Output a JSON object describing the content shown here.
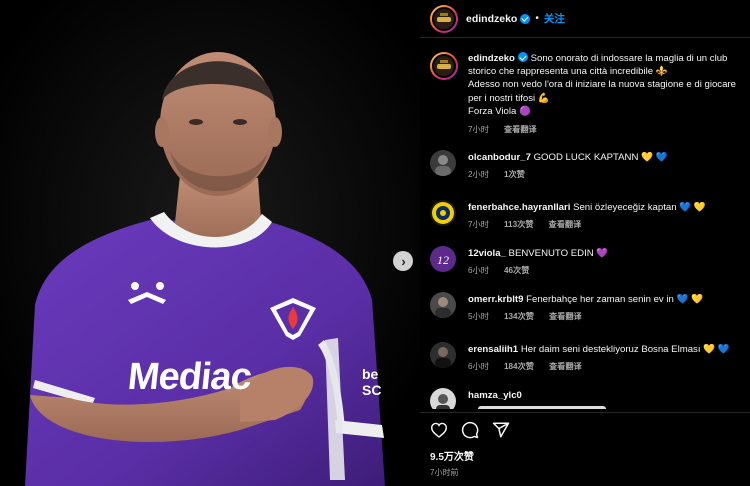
{
  "post": {
    "author": "edindzeko",
    "follow_label": "关注",
    "separator": "•",
    "caption": {
      "line1": "Sono onorato di indossare la maglia di un club storico che rappresenta una città incredibile ⚜️",
      "line2": "Adesso non vedo l'ora di iniziare la nuova stagione e di giocare per i nostri tifosi 💪",
      "line3": "Forza Viola 🟣",
      "time": "7小时",
      "translate": "查看翻译"
    },
    "likes": "9.5万次赞",
    "posted_ago": "7小时前"
  },
  "photo": {
    "jersey_sponsor": "Mediac",
    "jersey_sponsor_right": "be\nSC",
    "slide_count": 2,
    "active_slide": 0
  },
  "comments": [
    {
      "user": "olcanbodur_7",
      "text": "GOOD LUCK KAPTANN 💛 💙",
      "time": "2小时",
      "likes": "1次赞",
      "translate": "",
      "avatar_color": "#3b3b3b"
    },
    {
      "user": "fenerbahce.hayranllari",
      "text": "Seni özleyeceğiz kaptan 💙 💛",
      "time": "7小时",
      "likes": "113次赞",
      "translate": "查看翻译",
      "avatar_color": "#f2d000"
    },
    {
      "user": "12viola_",
      "text": "BENVENUTO EDIN 💜",
      "time": "6小时",
      "likes": "46次赞",
      "translate": "",
      "avatar_color": "#5d2a8c"
    },
    {
      "user": "omerr.krblt9",
      "text": "Fenerbahçe her zaman senin ev in 💙 💛",
      "time": "5小时",
      "likes": "134次赞",
      "translate": "查看翻译",
      "avatar_color": "#4a4a4a"
    },
    {
      "user": "erensaliih1",
      "text": "Her daim seni destekliyoruz Bosna Elması 💛 💙",
      "time": "6小时",
      "likes": "184次赞",
      "translate": "查看翻译",
      "avatar_color": "#2e2e2e"
    },
    {
      "user": "hamza_ylc0",
      "text": "",
      "time": "",
      "likes": "",
      "translate": "",
      "avatar_color": "#d9d9d9"
    }
  ],
  "icons": [
    "heart-icon",
    "comment-icon",
    "share-icon",
    "next-arrow-icon",
    "verified-badge-icon"
  ],
  "colors": {
    "accent": "#0095f6",
    "jersey": "#5a2ea6",
    "background": "#000000"
  }
}
